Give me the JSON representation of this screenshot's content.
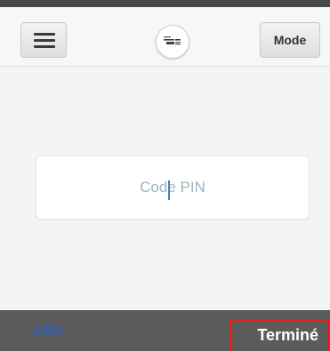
{
  "header": {
    "menu_icon": "hamburger-menu-icon",
    "logo_icon": "app-logo-icon",
    "mode_label": "Mode"
  },
  "pin": {
    "placeholder": "Code PIN",
    "value": ""
  },
  "keyboard": {
    "abc_label": "ABC",
    "done_label": "Terminé"
  },
  "colors": {
    "accent_blue": "#1f5fd1",
    "highlight_red": "#e0201e",
    "keyboard_bar": "#5b5b5b"
  }
}
